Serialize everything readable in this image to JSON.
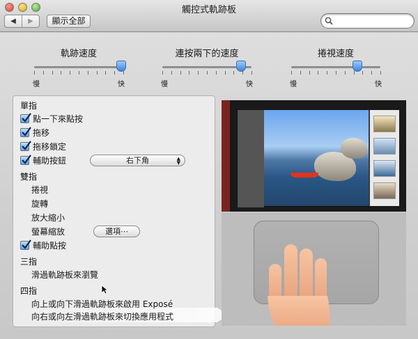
{
  "window": {
    "title": "觸控式軌跡板"
  },
  "toolbar": {
    "back_icon": "◀",
    "forward_icon": "▶",
    "show_all_label": "顯示全部",
    "search_placeholder": "",
    "search_value": ""
  },
  "sliders": [
    {
      "title": "軌跡速度",
      "min_label": "慢",
      "max_label": "快",
      "value": 0.98
    },
    {
      "title": "連按兩下的速度",
      "min_label": "慢",
      "max_label": "快",
      "value": 0.88
    },
    {
      "title": "捲視速度",
      "min_label": "慢",
      "max_label": "快",
      "value": 0.74
    }
  ],
  "gestures": {
    "one_finger": {
      "heading": "單指",
      "tap_to_click": {
        "label": "點一下來點按",
        "checked": true
      },
      "dragging": {
        "label": "拖移",
        "checked": true
      },
      "drag_lock": {
        "label": "拖移鎖定",
        "checked": true
      },
      "secondary_click": {
        "label": "輔助按鈕",
        "checked": true,
        "option": "右下角"
      }
    },
    "two_fingers": {
      "heading": "雙指",
      "scroll": "捲視",
      "rotate": "旋轉",
      "zoom": "放大縮小",
      "screen_zoom": "螢幕縮放",
      "options_button": "選項⋯",
      "secondary_tap": {
        "label": "輔助點按",
        "checked": true
      }
    },
    "three_fingers": {
      "heading": "三指",
      "swipe": "滑過軌跡板來瀏覽"
    },
    "four_fingers": {
      "heading": "四指",
      "expose": "向上或向下滑過軌跡板來啟用 Exposé",
      "switch_apps": "向右或向左滑過軌跡板來切換應用程式"
    }
  },
  "icons": {
    "search": "magnifier-icon",
    "checkbox": "checkmark-icon",
    "popup": "up-down-arrows-icon",
    "cursor": "arrow-pointer-icon"
  },
  "colors": {
    "accent": "#3a86e0",
    "panel": "#ececec",
    "background": "#d6d6d6"
  }
}
